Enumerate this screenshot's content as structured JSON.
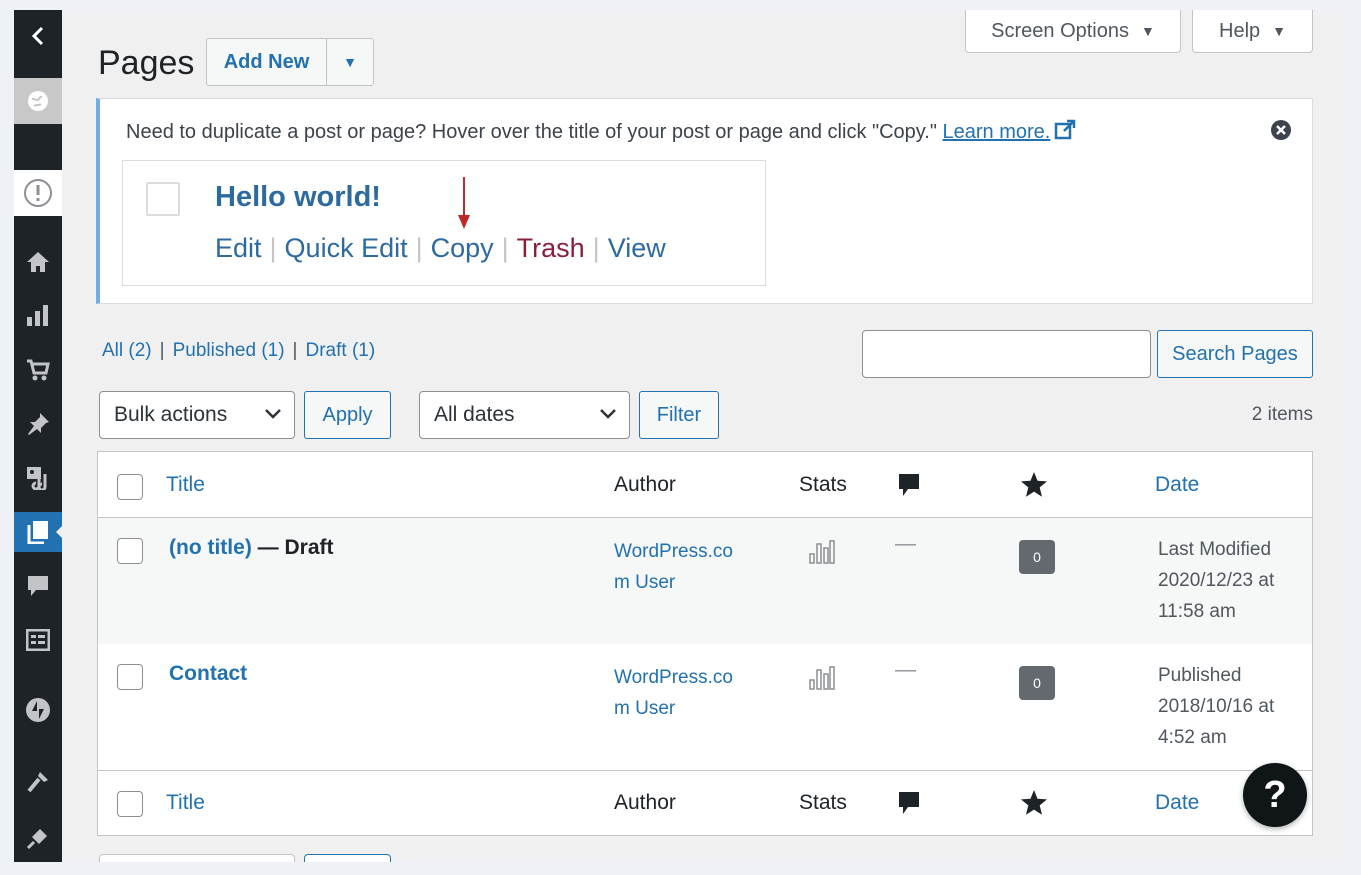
{
  "header": {
    "title": "Pages",
    "add_new": "Add New",
    "screen_options": "Screen Options",
    "help": "Help"
  },
  "notice": {
    "text": "Need to duplicate a post or page? Hover over the title of your post or page and click \"Copy.\"",
    "link": "Learn more.",
    "demo": {
      "title": "Hello world!",
      "actions": {
        "edit": "Edit",
        "quick_edit": "Quick Edit",
        "copy": "Copy",
        "trash": "Trash",
        "view": "View"
      }
    }
  },
  "filters": {
    "all": "All",
    "all_count": "(2)",
    "published": "Published",
    "published_count": "(1)",
    "draft": "Draft",
    "draft_count": "(1)"
  },
  "search": {
    "button": "Search Pages",
    "value": ""
  },
  "tablenav": {
    "bulk_selected": "Bulk actions",
    "apply": "Apply",
    "dates_selected": "All dates",
    "filter": "Filter",
    "count": "2 items"
  },
  "table": {
    "columns": {
      "title": "Title",
      "author": "Author",
      "stats": "Stats",
      "date": "Date"
    },
    "rows": [
      {
        "title": "(no title)",
        "state": "— Draft",
        "author": "WordPress.com User",
        "comments": "—",
        "likes": "0",
        "date_status": "Last Modified",
        "date": "2020/12/23 at 11:58 am"
      },
      {
        "title": "Contact",
        "state": "",
        "author": "WordPress.com User",
        "comments": "—",
        "likes": "0",
        "date_status": "Published",
        "date": "2018/10/16 at 4:52 am"
      }
    ]
  },
  "help_fab": "?",
  "colors": {
    "link": "#2271b1",
    "sidebar": "#1d2327",
    "active": "#2271b1",
    "trash": "#8a1f3a",
    "notice_border": "#72aee6"
  },
  "icons": [
    "chevron-left-icon",
    "site-icon",
    "alert-icon",
    "home-icon",
    "stats-icon",
    "cart-icon",
    "pin-icon",
    "media-icon",
    "pages-icon",
    "comment-icon",
    "forms-icon",
    "jetpack-icon",
    "tools-icon",
    "plugins-icon",
    "star-icon",
    "close-icon",
    "external-link-icon"
  ]
}
